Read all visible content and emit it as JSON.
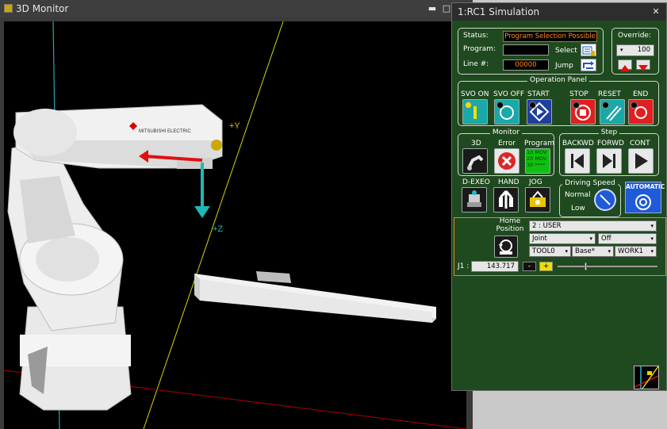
{
  "monitor": {
    "title": "3D Monitor",
    "axis_y_label": "+Y",
    "axis_z_label": "+Z",
    "robot_logo_text": "MITSUBISHI ELECTRIC"
  },
  "simulation": {
    "title": "1:RC1  Simulation",
    "status_label": "Status:",
    "status_value": "Program Selection Possible",
    "program_label": "Program:",
    "program_value": "",
    "select_label": "Select",
    "line_label": "Line #:",
    "line_value": "00000",
    "jump_label": "Jump",
    "override_label": "Override:",
    "override_value": "100",
    "operation_panel": {
      "title": "Operation Panel",
      "svo_on": "SVO ON",
      "svo_off": "SVO OFF",
      "start": "START",
      "stop": "STOP",
      "reset": "RESET",
      "end": "END"
    },
    "monitor_group": {
      "title": "Monitor",
      "btn_3d": "3D",
      "btn_error": "Error",
      "btn_program": "Program",
      "program_lines": [
        "10 MOV",
        "20 MOV",
        "30 ****"
      ]
    },
    "step_group": {
      "title": "Step",
      "backwd": "BACKWD",
      "forwd": "FORWD",
      "cont": "CONT"
    },
    "d_exeo": "D-EXEO",
    "hand": "HAND",
    "jog": "JOG",
    "driving_speed": {
      "title": "Driving Speed",
      "normal": "Normal",
      "low": "Low"
    },
    "automatic_label": "AUTOMATIC",
    "jog_panel": {
      "home_position_label": "Home Position",
      "frame_value": "2 : USER",
      "mode_value": "Joint",
      "option_value": "Off",
      "tool_value": "TOOL0",
      "base_value": "Base*",
      "work_value": "WORK1",
      "axis_label": "J1 :",
      "axis_value": "143.717",
      "minus_label": "-",
      "plus_label": "+"
    }
  },
  "colors": {
    "panel_green": "#1f4a1f",
    "status_orange": "#ff8c1a",
    "jog_border": "#e08a1e",
    "stop_red": "#e02020",
    "svo_teal": "#1aa8a8"
  }
}
